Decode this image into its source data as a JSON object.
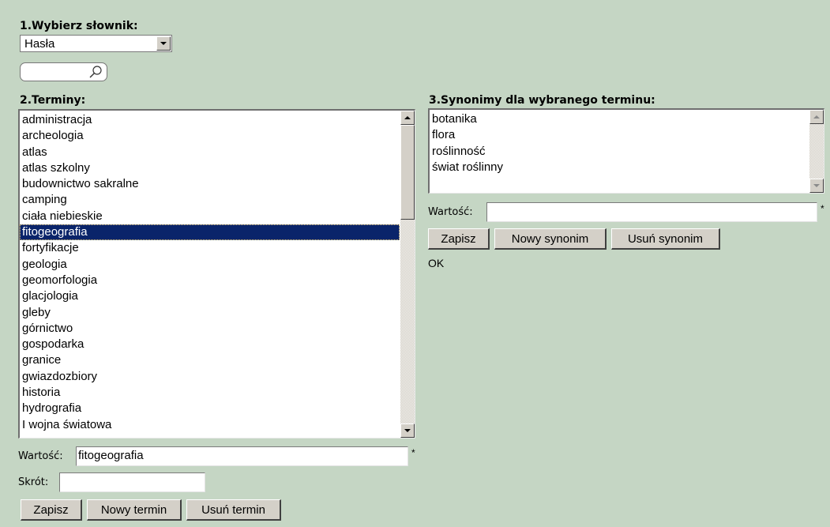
{
  "dictionary": {
    "heading": "1.Wybierz słownik:",
    "selected": "Hasła"
  },
  "search": {
    "value": ""
  },
  "terms": {
    "heading": "2.Terminy:",
    "items": [
      "administracja",
      "archeologia",
      "atlas",
      "atlas szkolny",
      "budownictwo sakralne",
      "camping",
      "ciała niebieskie",
      "fitogeografia",
      "fortyfikacje",
      "geologia",
      "geomorfologia",
      "glacjologia",
      "gleby",
      "górnictwo",
      "gospodarka",
      "granice",
      "gwiazdozbiory",
      "historia",
      "hydrografia",
      "I wojna światowa"
    ],
    "selected_index": 7,
    "value_label": "Wartość:",
    "value": "fitogeografia",
    "required_mark": "*",
    "abbrev_label": "Skrót:",
    "abbrev_value": "",
    "buttons": {
      "save": "Zapisz",
      "new": "Nowy termin",
      "delete": "Usuń termin"
    }
  },
  "synonyms": {
    "heading": "3.Synonimy dla wybranego terminu:",
    "items": [
      "botanika",
      "flora",
      "roślinność",
      "świat roślinny"
    ],
    "value_label": "Wartość:",
    "value": "",
    "required_mark": "*",
    "buttons": {
      "save": "Zapisz",
      "new": "Nowy synonim",
      "delete": "Usuń synonim"
    },
    "status": "OK"
  }
}
